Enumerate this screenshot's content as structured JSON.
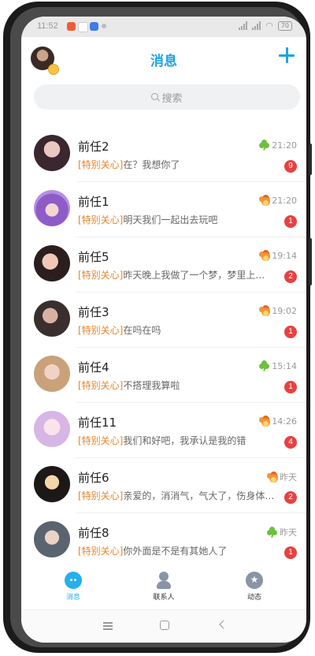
{
  "status": {
    "time": "11:52",
    "battery": "70"
  },
  "header": {
    "title": "消息"
  },
  "search": {
    "placeholder": "搜索"
  },
  "tag": "[特别关心]",
  "chats": [
    {
      "name": "前任2",
      "message": "在？我想你了",
      "time": "21:20",
      "badge": "9",
      "icon": "clover-icon"
    },
    {
      "name": "前任1",
      "message": "明天我们一起出去玩吧",
      "time": "21:20",
      "badge": "1",
      "icon": "flame-icon"
    },
    {
      "name": "前任5",
      "message": "昨天晚上我做了一个梦，梦里上…",
      "time": "19:14",
      "badge": "2",
      "icon": "flame-icon"
    },
    {
      "name": "前任3",
      "message": "在吗在吗",
      "time": "19:02",
      "badge": "1",
      "icon": "flame-icon"
    },
    {
      "name": "前任4",
      "message": "不搭理我算啦",
      "time": "15:14",
      "badge": "1",
      "icon": "clover-icon"
    },
    {
      "name": "前任11",
      "message": "我们和好吧，我承认是我的错",
      "time": "14:26",
      "badge": "4",
      "icon": "flame-icon"
    },
    {
      "name": "前任6",
      "message": "亲爱的，消消气，气大了，伤身体…",
      "time": "昨天",
      "badge": "2",
      "icon": "flame-icon"
    },
    {
      "name": "前任8",
      "message": "你外面是不是有其她人了",
      "time": "昨天",
      "badge": "1",
      "icon": "clover-icon"
    }
  ],
  "tabs": [
    {
      "label": "消息"
    },
    {
      "label": "联系人"
    },
    {
      "label": "动态"
    }
  ],
  "colors": {
    "accent": "#1fa3e0",
    "badge": "#e64141",
    "tag": "#e8852a"
  }
}
